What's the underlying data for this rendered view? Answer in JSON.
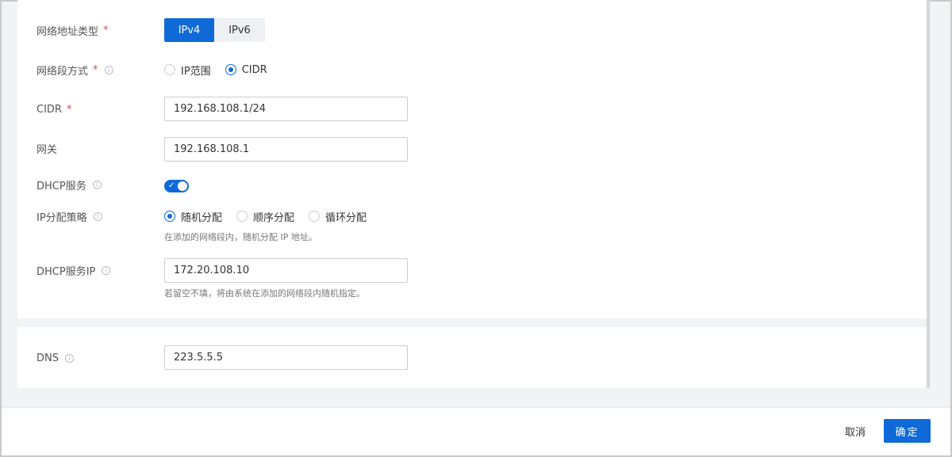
{
  "form": {
    "address_type": {
      "label": "网络地址类型",
      "required_mark": "*",
      "options": [
        "IPv4",
        "IPv6"
      ],
      "selected": "IPv4"
    },
    "segment_mode": {
      "label": "网络段方式",
      "required_mark": "*",
      "options": [
        "IP范围",
        "CIDR"
      ],
      "selected": "CIDR"
    },
    "cidr": {
      "label": "CIDR",
      "required_mark": "*",
      "value": "192.168.108.1/24"
    },
    "gateway": {
      "label": "网关",
      "value": "192.168.108.1"
    },
    "dhcp_service": {
      "label": "DHCP服务",
      "enabled": true,
      "check_glyph": "✓"
    },
    "ip_strategy": {
      "label": "IP分配策略",
      "options": [
        "随机分配",
        "顺序分配",
        "循环分配"
      ],
      "selected": "随机分配",
      "hint": "在添加的网络段内，随机分配 IP 地址。"
    },
    "dhcp_ip": {
      "label": "DHCP服务IP",
      "value": "172.20.108.10",
      "hint": "若留空不填，将由系统在添加的网络段内随机指定。"
    },
    "dns": {
      "label": "DNS",
      "value": "223.5.5.5"
    }
  },
  "info_glyph": "i",
  "footer": {
    "cancel_label": "取消",
    "confirm_label": "确定"
  },
  "colors": {
    "primary": "#0f6ad8",
    "required": "#e54545"
  }
}
